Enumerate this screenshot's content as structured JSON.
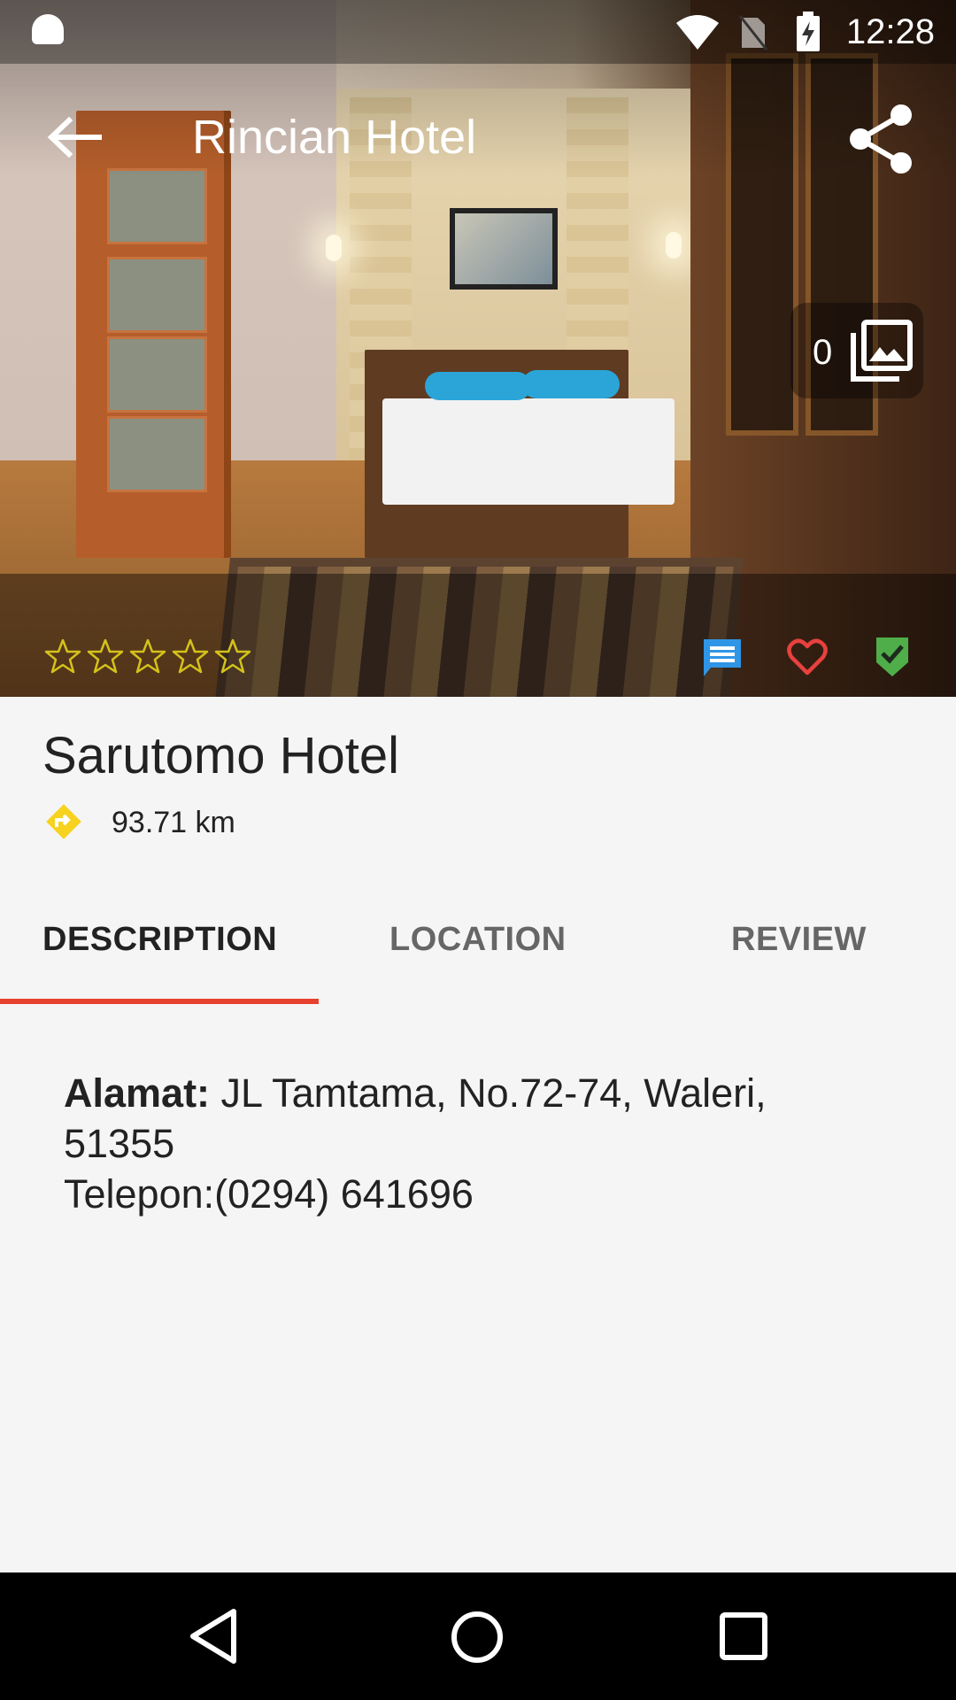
{
  "status_bar": {
    "time": "12:28",
    "icons": [
      "android-bot-icon",
      "wifi-icon",
      "no-sim-icon",
      "battery-charging-icon"
    ]
  },
  "toolbar": {
    "title": "Rincian Hotel",
    "back_icon": "arrow-back-icon",
    "share_icon": "share-icon"
  },
  "gallery": {
    "count": "0",
    "icon": "photo-library-icon"
  },
  "rating": {
    "stars_filled": 0,
    "stars_total": 5,
    "star_color": "#d4c21a"
  },
  "actions": {
    "comment_icon": "comment-icon",
    "comment_color": "#2f95e6",
    "favorite_icon": "heart-outline-icon",
    "favorite_color": "#e8413e",
    "verified_icon": "verified-check-icon",
    "verified_color": "#4fae49"
  },
  "hotel": {
    "name": "Sarutomo Hotel",
    "distance": "93.71 km",
    "distance_icon": "directions-icon",
    "distance_icon_color": "#f7d21e"
  },
  "tabs": [
    {
      "label": "DESCRIPTION",
      "active": true
    },
    {
      "label": "LOCATION",
      "active": false
    },
    {
      "label": "REVIEW",
      "active": false
    }
  ],
  "tab_indicator_color": "#e8402f",
  "description": {
    "address_label": "Alamat:",
    "address": " JL Tamtama, No.72-74, Waleri, 51355",
    "phone": "Telepon:(0294) 641696"
  },
  "nav_bar": {
    "icons": [
      "nav-back-icon",
      "nav-home-icon",
      "nav-recents-icon"
    ]
  }
}
